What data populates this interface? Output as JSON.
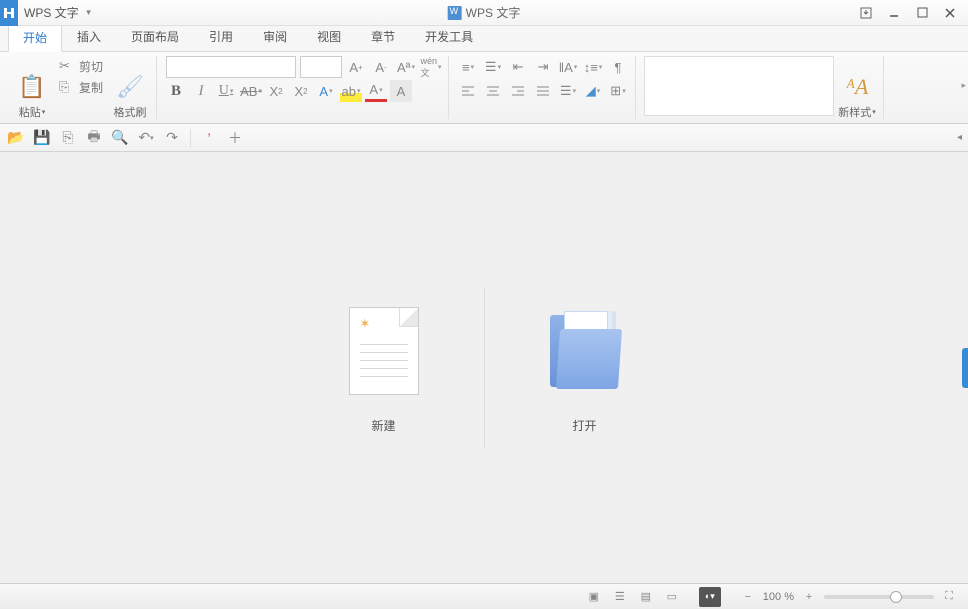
{
  "app": {
    "name": "WPS 文字",
    "doc_title": "WPS 文字"
  },
  "tabs": [
    "开始",
    "插入",
    "页面布局",
    "引用",
    "审阅",
    "视图",
    "章节",
    "开发工具"
  ],
  "active_tab": 0,
  "clipboard": {
    "paste": "粘贴",
    "cut": "剪切",
    "copy": "复制",
    "format_painter": "格式刷"
  },
  "styles_btn": "新样式",
  "launch": {
    "new_label": "新建",
    "open_label": "打开"
  },
  "status": {
    "zoom": "100 %"
  }
}
